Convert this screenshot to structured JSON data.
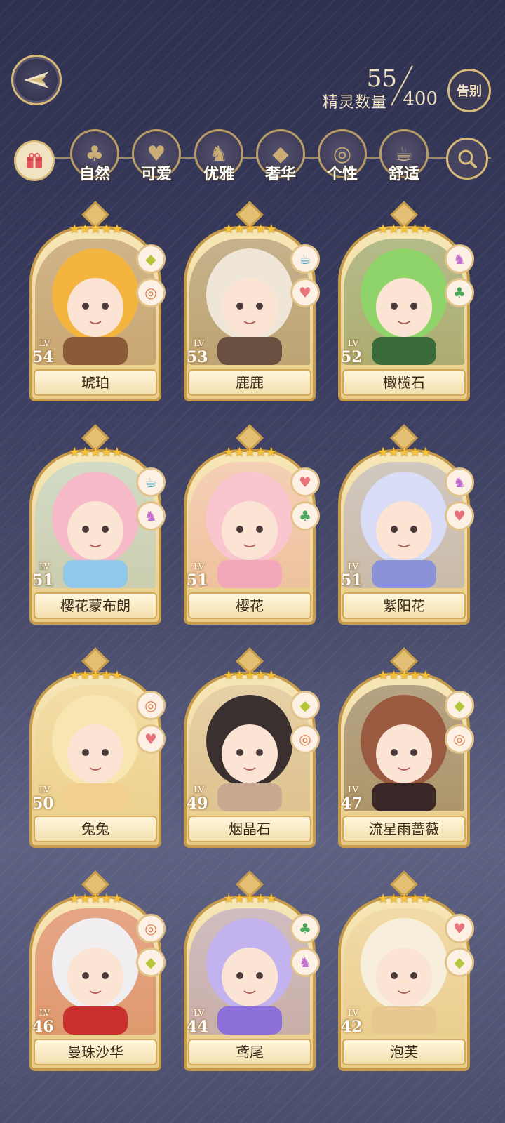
{
  "header": {
    "count_current": "55",
    "count_label": "精灵数量",
    "count_max": "400",
    "farewell_label": "告别"
  },
  "filters": [
    {
      "label": "自然",
      "icon": "clover-icon",
      "glyph": "♣"
    },
    {
      "label": "可爱",
      "icon": "heart-icon",
      "glyph": "♥"
    },
    {
      "label": "优雅",
      "icon": "swan-icon",
      "glyph": "♞"
    },
    {
      "label": "奢华",
      "icon": "diamond-icon",
      "glyph": "◆"
    },
    {
      "label": "个性",
      "icon": "glasses-icon",
      "glyph": "◎"
    },
    {
      "label": "舒适",
      "icon": "teacup-icon",
      "glyph": "☕"
    }
  ],
  "trait_colors": {
    "diamond": "#b4c63a",
    "glasses": "#e07a44",
    "teacup": "#4ea8c8",
    "heart": "#e8737a",
    "swan": "#c46fd0",
    "clover": "#4aa75a"
  },
  "cards": [
    {
      "name": "琥珀",
      "level": "54",
      "stars": "★★★★★",
      "traits": [
        "diamond",
        "glasses"
      ]
    },
    {
      "name": "鹿鹿",
      "level": "53",
      "stars": "★★★★★",
      "traits": [
        "teacup",
        "heart"
      ]
    },
    {
      "name": "橄榄石",
      "level": "52",
      "stars": "★★★★★",
      "traits": [
        "swan",
        "clover"
      ]
    },
    {
      "name": "樱花蒙布朗",
      "level": "51",
      "stars": "★★★★★",
      "traits": [
        "teacup",
        "swan"
      ]
    },
    {
      "name": "樱花",
      "level": "51",
      "stars": "★★★★★",
      "traits": [
        "heart",
        "clover"
      ]
    },
    {
      "name": "紫阳花",
      "level": "51",
      "stars": "★★★★★",
      "traits": [
        "swan",
        "heart"
      ]
    },
    {
      "name": "兔兔",
      "level": "50",
      "stars": "★★★★★",
      "traits": [
        "glasses",
        "heart"
      ]
    },
    {
      "name": "烟晶石",
      "level": "49",
      "stars": "★★★★★",
      "traits": [
        "diamond",
        "glasses"
      ]
    },
    {
      "name": "流星雨蔷薇",
      "level": "47",
      "stars": "★★★★★",
      "traits": [
        "diamond",
        "glasses"
      ]
    },
    {
      "name": "曼珠沙华",
      "level": "46",
      "stars": "★★★★★",
      "traits": [
        "glasses",
        "diamond"
      ]
    },
    {
      "name": "鸢尾",
      "level": "44",
      "stars": "★★★★★",
      "traits": [
        "clover",
        "swan"
      ]
    },
    {
      "name": "泡芙",
      "level": "42",
      "stars": "★★★★★",
      "traits": [
        "heart",
        "diamond"
      ]
    }
  ],
  "lv_tag": "LV"
}
